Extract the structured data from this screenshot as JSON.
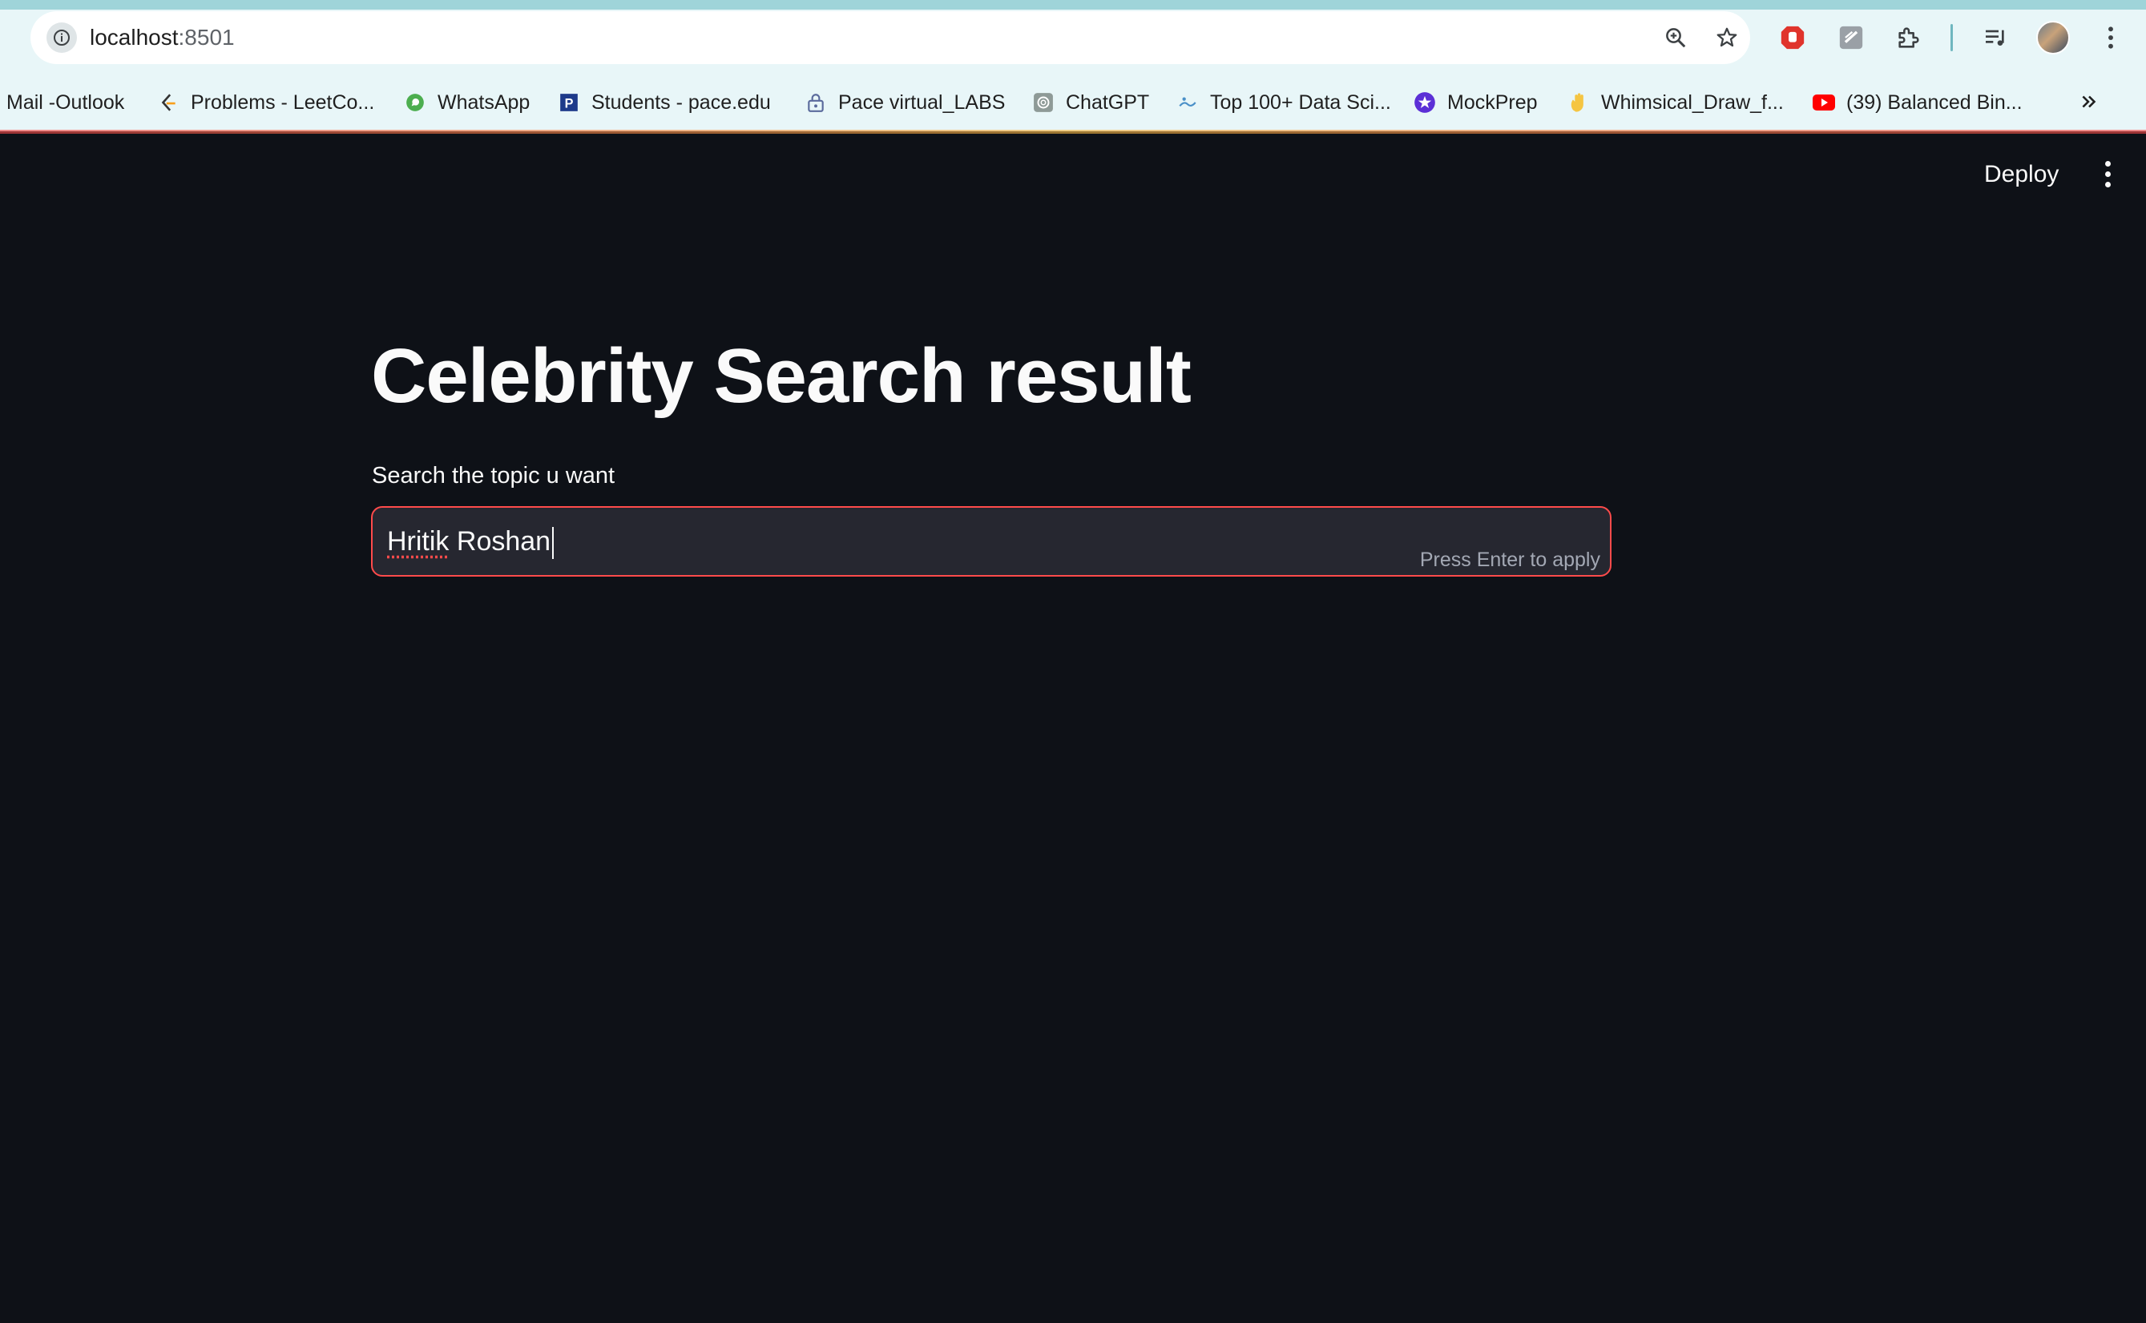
{
  "browser": {
    "url_host": "localhost",
    "url_port": ":8501",
    "bookmarks": [
      {
        "label": "Mail -Outlook",
        "icon": "outlook-icon"
      },
      {
        "label": "Problems - LeetCo...",
        "icon": "leetcode-icon"
      },
      {
        "label": "WhatsApp",
        "icon": "whatsapp-icon"
      },
      {
        "label": "Students - pace.edu",
        "icon": "pace-icon"
      },
      {
        "label": "Pace virtual_LABS",
        "icon": "lock-icon"
      },
      {
        "label": "ChatGPT",
        "icon": "chatgpt-icon"
      },
      {
        "label": "Top 100+ Data Sci...",
        "icon": "data-sci-icon"
      },
      {
        "label": "MockPrep",
        "icon": "mockprep-icon"
      },
      {
        "label": "Whimsical_Draw_f...",
        "icon": "wave-hand-icon"
      },
      {
        "label": "(39) Balanced Bin...",
        "icon": "youtube-icon"
      }
    ],
    "colors": {
      "chrome_bg": "#e8f6f8",
      "app_bg": "#0e1117",
      "accent": "#ff4b4b"
    }
  },
  "app": {
    "deploy_label": "Deploy",
    "title": "Celebrity Search result",
    "input_label": "Search the topic u want",
    "input_value_first": "Hritik",
    "input_value_rest": " Roshan",
    "input_hint": "Press Enter to apply"
  }
}
